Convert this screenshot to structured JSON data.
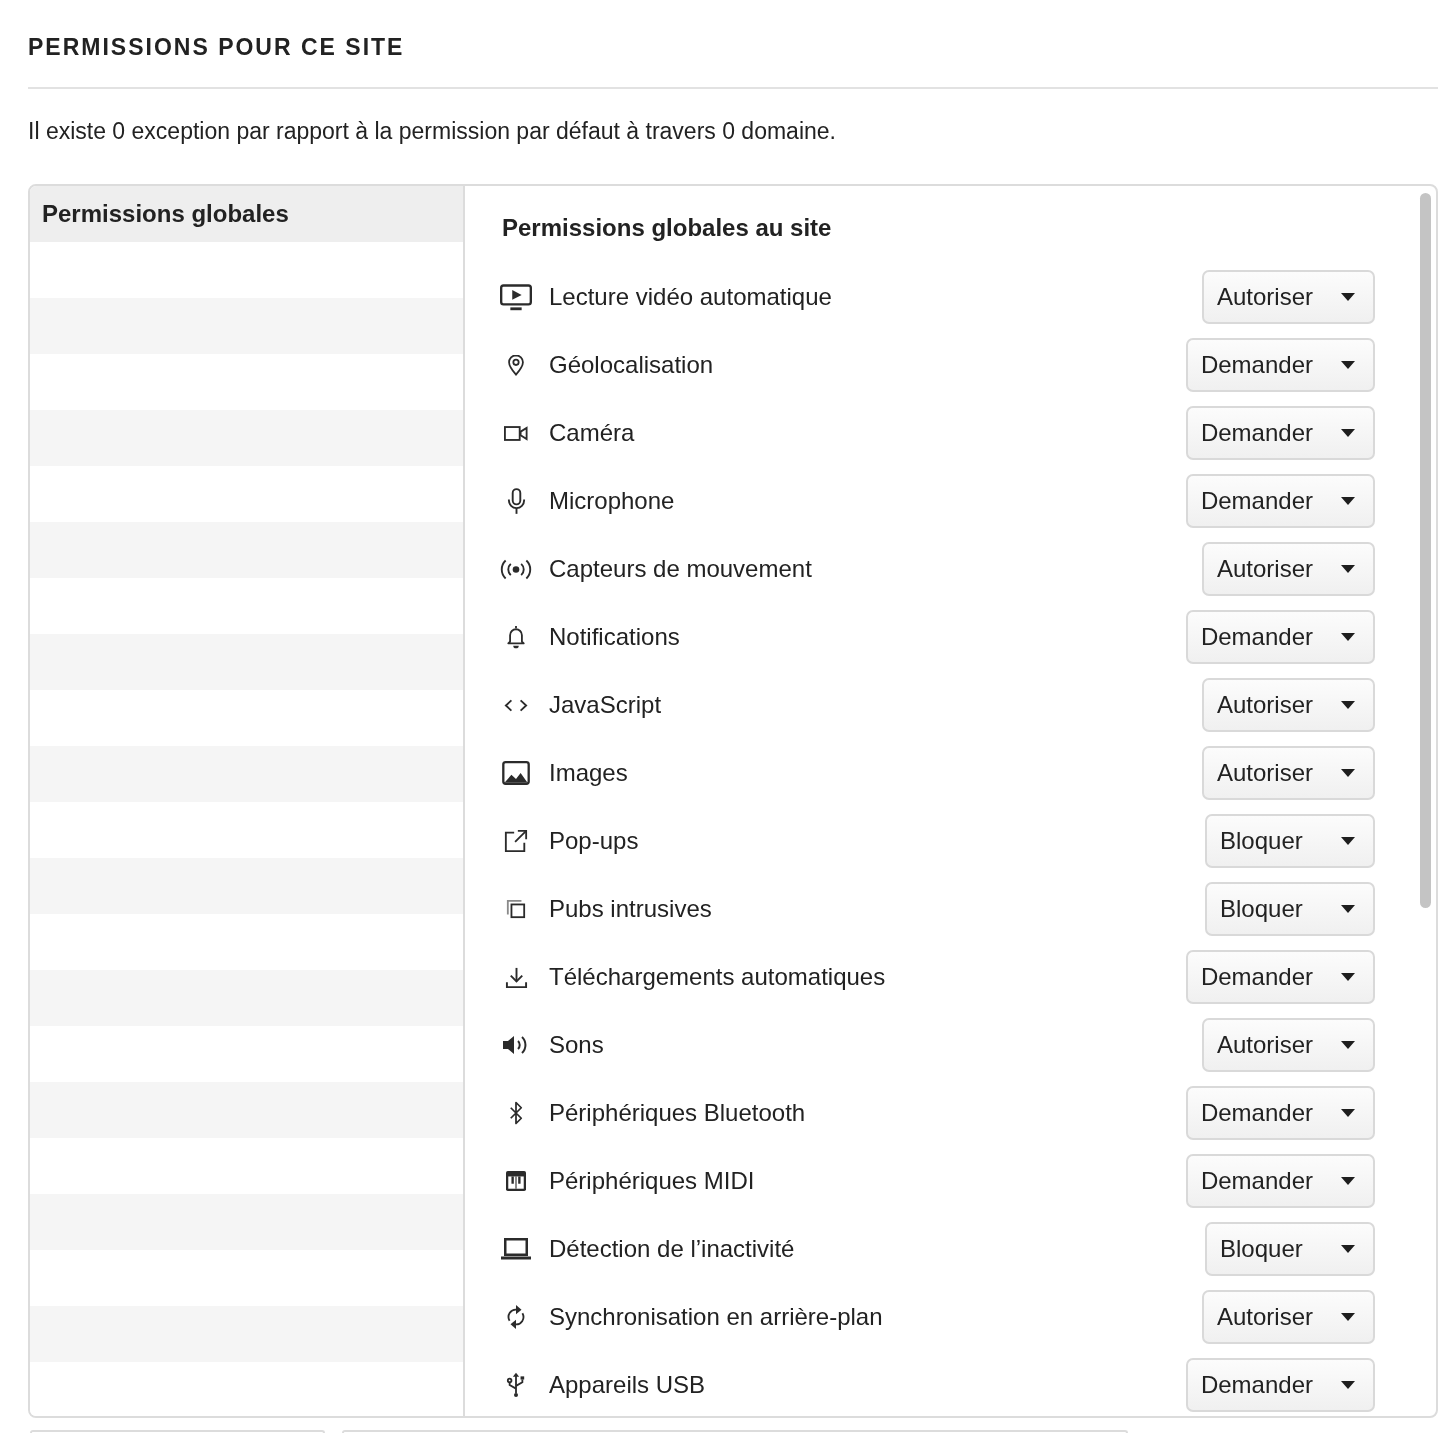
{
  "section_title": "PERMISSIONS POUR CE SITE",
  "summary": "Il existe 0 exception par rapport à la permission par défaut à travers 0 domaine.",
  "sidebar": {
    "header": "Permissions globales"
  },
  "panel": {
    "title": "Permissions globales au site",
    "permissions": [
      {
        "kind": "autoplay",
        "label": "Lecture vidéo automatique",
        "value": "Autoriser"
      },
      {
        "kind": "location",
        "label": "Géolocalisation",
        "value": "Demander"
      },
      {
        "kind": "camera",
        "label": "Caméra",
        "value": "Demander"
      },
      {
        "kind": "microphone",
        "label": "Microphone",
        "value": "Demander"
      },
      {
        "kind": "sensors",
        "label": "Capteurs de mouvement",
        "value": "Autoriser"
      },
      {
        "kind": "notifications",
        "label": "Notifications",
        "value": "Demander"
      },
      {
        "kind": "javascript",
        "label": "JavaScript",
        "value": "Autoriser"
      },
      {
        "kind": "images",
        "label": "Images",
        "value": "Autoriser"
      },
      {
        "kind": "popups",
        "label": "Pop-ups",
        "value": "Bloquer"
      },
      {
        "kind": "ads",
        "label": "Pubs intrusives",
        "value": "Bloquer"
      },
      {
        "kind": "downloads",
        "label": "Téléchargements automatiques",
        "value": "Demander"
      },
      {
        "kind": "sound",
        "label": "Sons",
        "value": "Autoriser"
      },
      {
        "kind": "bluetooth",
        "label": "Périphériques Bluetooth",
        "value": "Demander"
      },
      {
        "kind": "midi",
        "label": "Périphériques MIDI",
        "value": "Demander"
      },
      {
        "kind": "idle",
        "label": "Détection de l’inactivité",
        "value": "Bloquer"
      },
      {
        "kind": "sync",
        "label": "Synchronisation en arrière-plan",
        "value": "Autoriser"
      },
      {
        "kind": "usb",
        "label": "Appareils USB",
        "value": "Demander"
      }
    ]
  }
}
